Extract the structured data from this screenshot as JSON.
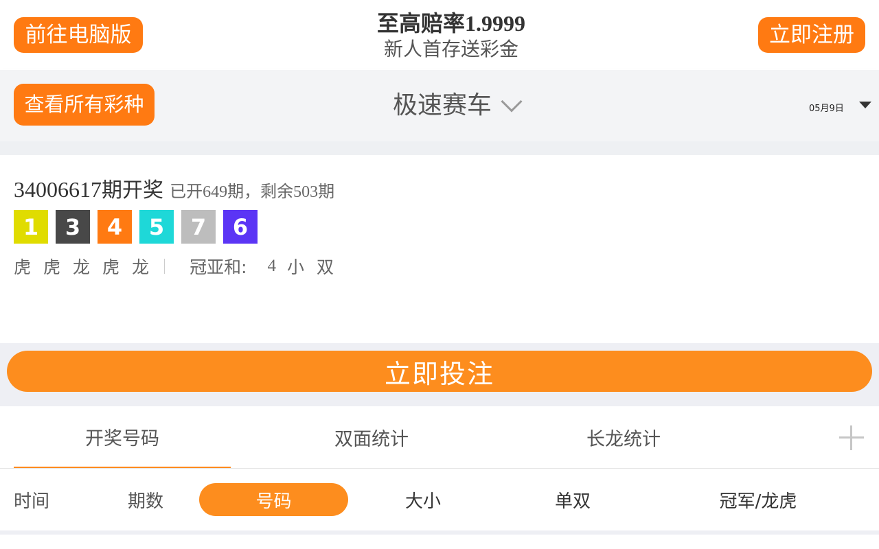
{
  "header": {
    "pc_button": "前往电脑版",
    "register_button": "立即注册",
    "promo_title": "至高赔率1.9999",
    "promo_subtitle": "新人首存送彩金"
  },
  "game_bar": {
    "all_games_button": "查看所有彩种",
    "game_name": "极速赛车",
    "date": "05月9日"
  },
  "result": {
    "issue_number": "34006617",
    "issue_suffix": "期开奖",
    "issue_stats": "已开649期，剩余503期",
    "balls": [
      {
        "number": "1",
        "color": "#e0dc00"
      },
      {
        "number": "3",
        "color": "#484848"
      },
      {
        "number": "4",
        "color": "#ff7a12"
      },
      {
        "number": "5",
        "color": "#1ed8d8"
      },
      {
        "number": "7",
        "color": "#bdbdbd"
      },
      {
        "number": "6",
        "color": "#5b35f5"
      }
    ],
    "dragon_tiger": [
      "虎",
      "虎",
      "龙",
      "虎",
      "龙"
    ],
    "sum_label": "冠亚和:",
    "sum_value": "4",
    "sum_size": "小",
    "sum_parity": "双"
  },
  "bet_button": "立即投注",
  "tabs": [
    "开奖号码",
    "双面统计",
    "长龙统计"
  ],
  "filters": {
    "time": "时间",
    "issue": "期数",
    "number": "号码",
    "size": "大小",
    "odd_even": "单双",
    "champion_dt": "冠军/龙虎"
  },
  "colors": {
    "accent": "#fd8d1e",
    "button_orange": "#ff7a12"
  }
}
